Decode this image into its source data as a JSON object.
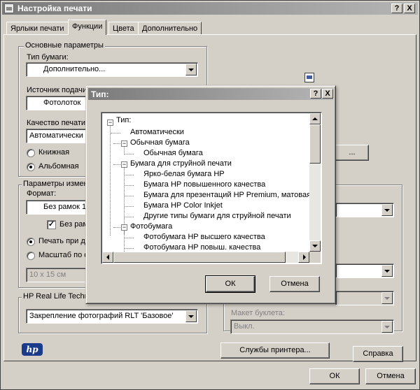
{
  "window": {
    "title": "Настройка печати",
    "help_btn": "?",
    "close_btn": "X"
  },
  "tabs": [
    "Ярлыки печати",
    "Функции",
    "Цвета",
    "Дополнительно"
  ],
  "basic": {
    "group_label": "Основные параметры",
    "paper_type_label": "Тип бумаги:",
    "paper_type_value": "Дополнительно...",
    "source_label": "Источник подачи",
    "source_value": "Фотолоток",
    "quality_label": "Качество печати",
    "quality_value": "Автоматически",
    "portrait": "Книжная",
    "landscape": "Альбомная"
  },
  "resize": {
    "group_label": "Параметры изменен",
    "format_label": "Формат:",
    "format_value": "Без рамок 1",
    "borderless_label": "Без рамо",
    "print_at_label": "Печать при де",
    "scale_label": "Масштаб по ф",
    "scale_value": "10 х 15 см"
  },
  "reallife": {
    "group_label": "HP Real Life Techno",
    "value": "Закрепление фотографий RLT 'Базовое'"
  },
  "right": {
    "booklet_label": "Макет буклета:",
    "booklet_value": "Выкл.",
    "printer_services_btn": "Службы принтера...",
    "help_btn": "Справка",
    "dots_btn": "..."
  },
  "logo_text": "hp",
  "bottom": {
    "ok": "ОК",
    "cancel": "Отмена"
  },
  "dialog": {
    "title": "Тип:",
    "help_btn": "?",
    "close_btn": "X",
    "ok": "ОК",
    "cancel": "Отмена",
    "tree": [
      "Тип:",
      "Автоматически",
      "Обычная бумага",
      "Обычная бумага",
      "Бумага для струйной печати",
      "Ярко-белая бумага HP",
      "Бумага HP повышенного качества",
      "Бумага для презентаций HP Premium, матовая",
      "Бумага HP Color Inkjet",
      "Другие типы бумаги для струйной печати",
      "Фотобумага",
      "Фотобумага HP высшего качества",
      "Фотобумага HP повыш. качества"
    ]
  }
}
